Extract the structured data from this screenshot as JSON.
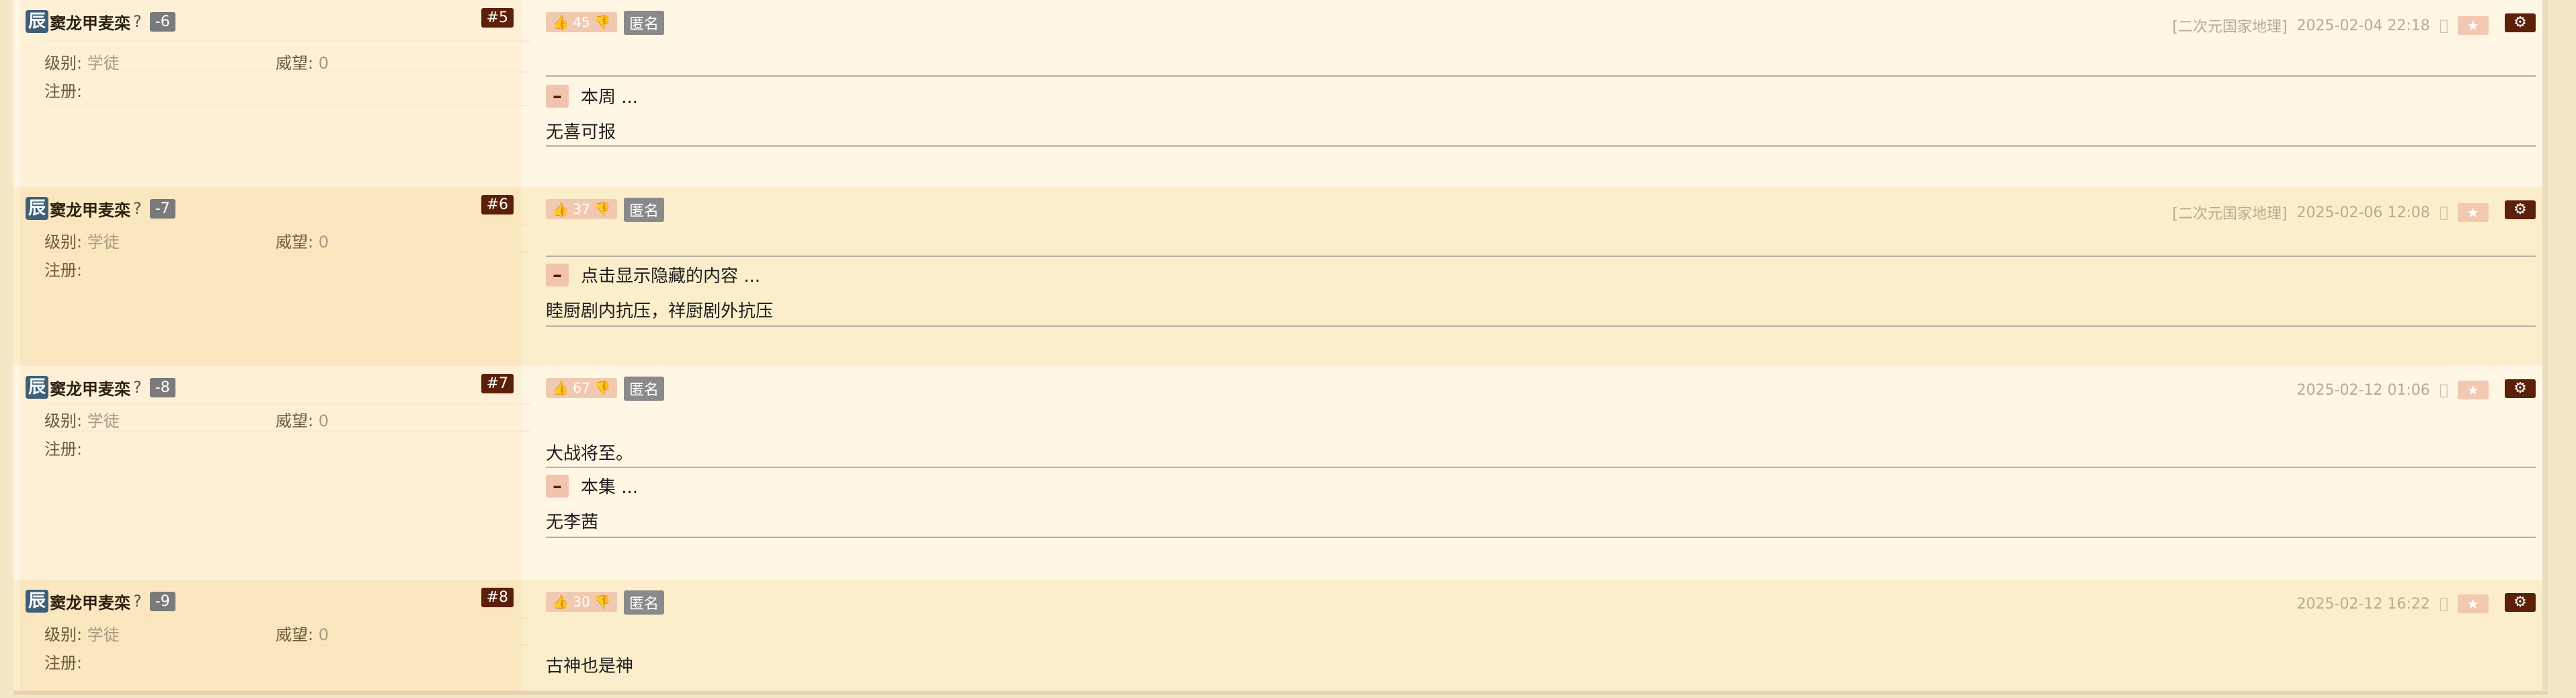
{
  "posts": [
    {
      "avatar": "辰",
      "user": "窦龙甲麦栾",
      "user_q": "?",
      "score": "-6",
      "floor": "#5",
      "level_label": "级别:",
      "level": "学徒",
      "rep_label": "威望:",
      "rep": "0",
      "reg_label": "注册:",
      "votes": "45",
      "anon": "匿名",
      "board": "[二次元国家地理]",
      "time": "2025-02-04 22:18",
      "collapse_label": "本周 ...",
      "text": "无喜可报"
    },
    {
      "avatar": "辰",
      "user": "窦龙甲麦栾",
      "user_q": "?",
      "score": "-7",
      "floor": "#6",
      "level_label": "级别:",
      "level": "学徒",
      "rep_label": "威望:",
      "rep": "0",
      "reg_label": "注册:",
      "votes": "37",
      "anon": "匿名",
      "board": "[二次元国家地理]",
      "time": "2025-02-06 12:08",
      "collapse_label": "点击显示隐藏的内容 ...",
      "text": "睦厨剧内抗压，祥厨剧外抗压"
    },
    {
      "avatar": "辰",
      "user": "窦龙甲麦栾",
      "user_q": "?",
      "score": "-8",
      "floor": "#7",
      "level_label": "级别:",
      "level": "学徒",
      "rep_label": "威望:",
      "rep": "0",
      "reg_label": "注册:",
      "votes": "67",
      "anon": "匿名",
      "board": "",
      "time": "2025-02-12 01:06",
      "text_top": "大战将至。",
      "collapse_label": "本集 ...",
      "text": "无李茜"
    },
    {
      "avatar": "辰",
      "user": "窦龙甲麦栾",
      "user_q": "?",
      "score": "-9",
      "floor": "#8",
      "level_label": "级别:",
      "level": "学徒",
      "rep_label": "威望:",
      "rep": "0",
      "reg_label": "注册:",
      "votes": "30",
      "anon": "匿名",
      "board": "",
      "time": "2025-02-12 16:22",
      "text": "古神也是神"
    }
  ],
  "icons": {
    "thumb_up": "thumbs-up-icon",
    "thumb_down": "thumbs-down-icon",
    "apple": "apple-icon",
    "star": "star-icon",
    "gear": "gear-icon",
    "collapse": "minus-icon"
  }
}
